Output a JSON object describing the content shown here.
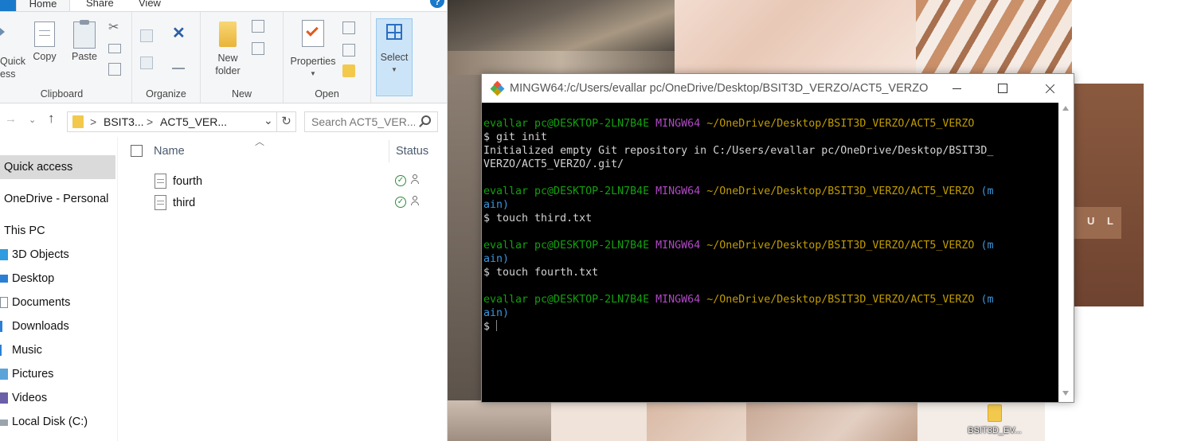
{
  "explorer": {
    "tabs": [
      "Home",
      "Share",
      "View"
    ],
    "help_glyph": "?",
    "ribbon": {
      "clipboard": {
        "group_label": "Clipboard",
        "quick_access_label_1": "Quick",
        "quick_access_label_2": "ess",
        "copy_label": "Copy",
        "paste_label": "Paste"
      },
      "organize": {
        "group_label": "Organize"
      },
      "new": {
        "group_label": "New",
        "new_folder_label_1": "New",
        "new_folder_label_2": "folder"
      },
      "open": {
        "group_label": "Open",
        "properties_label": "Properties"
      },
      "select": {
        "select_label": "Select"
      }
    },
    "address": {
      "segment_1": "BSIT3...",
      "segment_2": "ACT5_VER...",
      "search_placeholder": "Search ACT5_VER..."
    },
    "nav_pane": {
      "items": [
        {
          "label": "Quick access",
          "selected": true
        },
        {
          "label": "OneDrive - Personal"
        },
        {
          "label": "This PC"
        },
        {
          "label": "3D Objects",
          "icon": "cube-icon"
        },
        {
          "label": "Desktop",
          "icon": "desktop-icon"
        },
        {
          "label": "Documents",
          "icon": "documents-icon"
        },
        {
          "label": "Downloads",
          "icon": "download-icon"
        },
        {
          "label": "Music",
          "icon": "music-icon"
        },
        {
          "label": "Pictures",
          "icon": "pictures-icon"
        },
        {
          "label": "Videos",
          "icon": "videos-icon"
        },
        {
          "label": "Local Disk (C:)",
          "icon": "disk-icon"
        }
      ]
    },
    "columns": {
      "name": "Name",
      "status": "Status"
    },
    "files": [
      {
        "name": "fourth",
        "status": "synced"
      },
      {
        "name": "third",
        "status": "synced"
      }
    ]
  },
  "terminal": {
    "title": "MINGW64:/c/Users/evallar pc/OneDrive/Desktop/BSIT3D_VERZO/ACT5_VERZO",
    "lines": [
      [
        {
          "t": "evallar pc@DESKTOP-2LN7B4E ",
          "c": "green"
        },
        {
          "t": "MINGW64 ",
          "c": "purple"
        },
        {
          "t": "~/OneDrive/Desktop/BSIT3D_VERZO/ACT5_VERZO",
          "c": "yellow"
        }
      ],
      [
        {
          "t": "$ git init",
          "c": "white"
        }
      ],
      [
        {
          "t": "Initialized empty Git repository in C:/Users/evallar pc/OneDrive/Desktop/BSIT3D_",
          "c": "white"
        }
      ],
      [
        {
          "t": "VERZO/ACT5_VERZO/.git/",
          "c": "white"
        }
      ],
      [
        {
          "t": "",
          "c": "white"
        }
      ],
      [
        {
          "t": "evallar pc@DESKTOP-2LN7B4E ",
          "c": "green"
        },
        {
          "t": "MINGW64 ",
          "c": "purple"
        },
        {
          "t": "~/OneDrive/Desktop/BSIT3D_VERZO/ACT5_VERZO",
          "c": "yellow"
        },
        {
          "t": " (m",
          "c": "cyan"
        }
      ],
      [
        {
          "t": "ain)",
          "c": "cyan"
        }
      ],
      [
        {
          "t": "$ touch third.txt",
          "c": "white"
        }
      ],
      [
        {
          "t": "",
          "c": "white"
        }
      ],
      [
        {
          "t": "evallar pc@DESKTOP-2LN7B4E ",
          "c": "green"
        },
        {
          "t": "MINGW64 ",
          "c": "purple"
        },
        {
          "t": "~/OneDrive/Desktop/BSIT3D_VERZO/ACT5_VERZO",
          "c": "yellow"
        },
        {
          "t": " (m",
          "c": "cyan"
        }
      ],
      [
        {
          "t": "ain)",
          "c": "cyan"
        }
      ],
      [
        {
          "t": "$ touch fourth.txt",
          "c": "white"
        }
      ],
      [
        {
          "t": "",
          "c": "white"
        }
      ],
      [
        {
          "t": "evallar pc@DESKTOP-2LN7B4E ",
          "c": "green"
        },
        {
          "t": "MINGW64 ",
          "c": "purple"
        },
        {
          "t": "~/OneDrive/Desktop/BSIT3D_VERZO/ACT5_VERZO",
          "c": "yellow"
        },
        {
          "t": " (m",
          "c": "cyan"
        }
      ],
      [
        {
          "t": "ain)",
          "c": "cyan"
        }
      ],
      [
        {
          "t": "$",
          "c": "white"
        }
      ]
    ]
  },
  "desktop": {
    "wallpaper_text": "U L",
    "icon_label": "BSIT3D_EV..."
  }
}
